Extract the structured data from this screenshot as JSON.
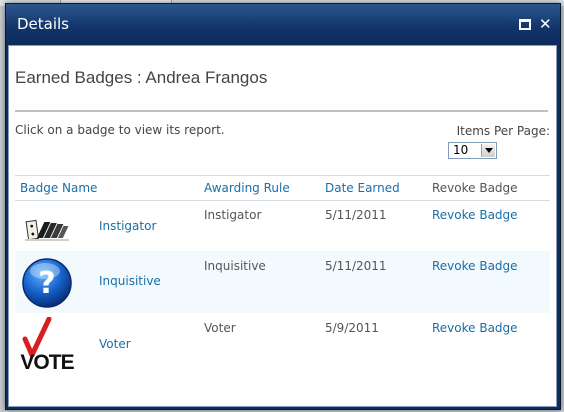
{
  "dialog": {
    "title": "Details",
    "maximize_icon": "maximize-icon",
    "close_icon": "close-icon",
    "close_glyph": "✕"
  },
  "page": {
    "heading": "Earned Badges : Andrea Frangos",
    "instruction": "Click on a badge to view its report.",
    "items_per_page_label": "Items Per Page:",
    "items_per_page_value": "10"
  },
  "table": {
    "headers": {
      "badge_name": "Badge Name",
      "awarding_rule": "Awarding Rule",
      "date_earned": "Date Earned",
      "revoke_badge": "Revoke Badge"
    },
    "rows": [
      {
        "badge": "Instigator",
        "icon": "dominoes-icon",
        "rule": "Instigator",
        "date": "5/11/2011",
        "revoke": "Revoke Badge"
      },
      {
        "badge": "Inquisitive",
        "icon": "question-mark-icon",
        "rule": "Inquisitive",
        "date": "5/11/2011",
        "revoke": "Revoke Badge"
      },
      {
        "badge": "Voter",
        "icon": "vote-icon",
        "rule": "Voter",
        "date": "5/9/2011",
        "revoke": "Revoke Badge"
      }
    ]
  },
  "colors": {
    "title_bar": "#12346a",
    "link": "#1a6ea8",
    "alt_row": "#f2fafd"
  }
}
